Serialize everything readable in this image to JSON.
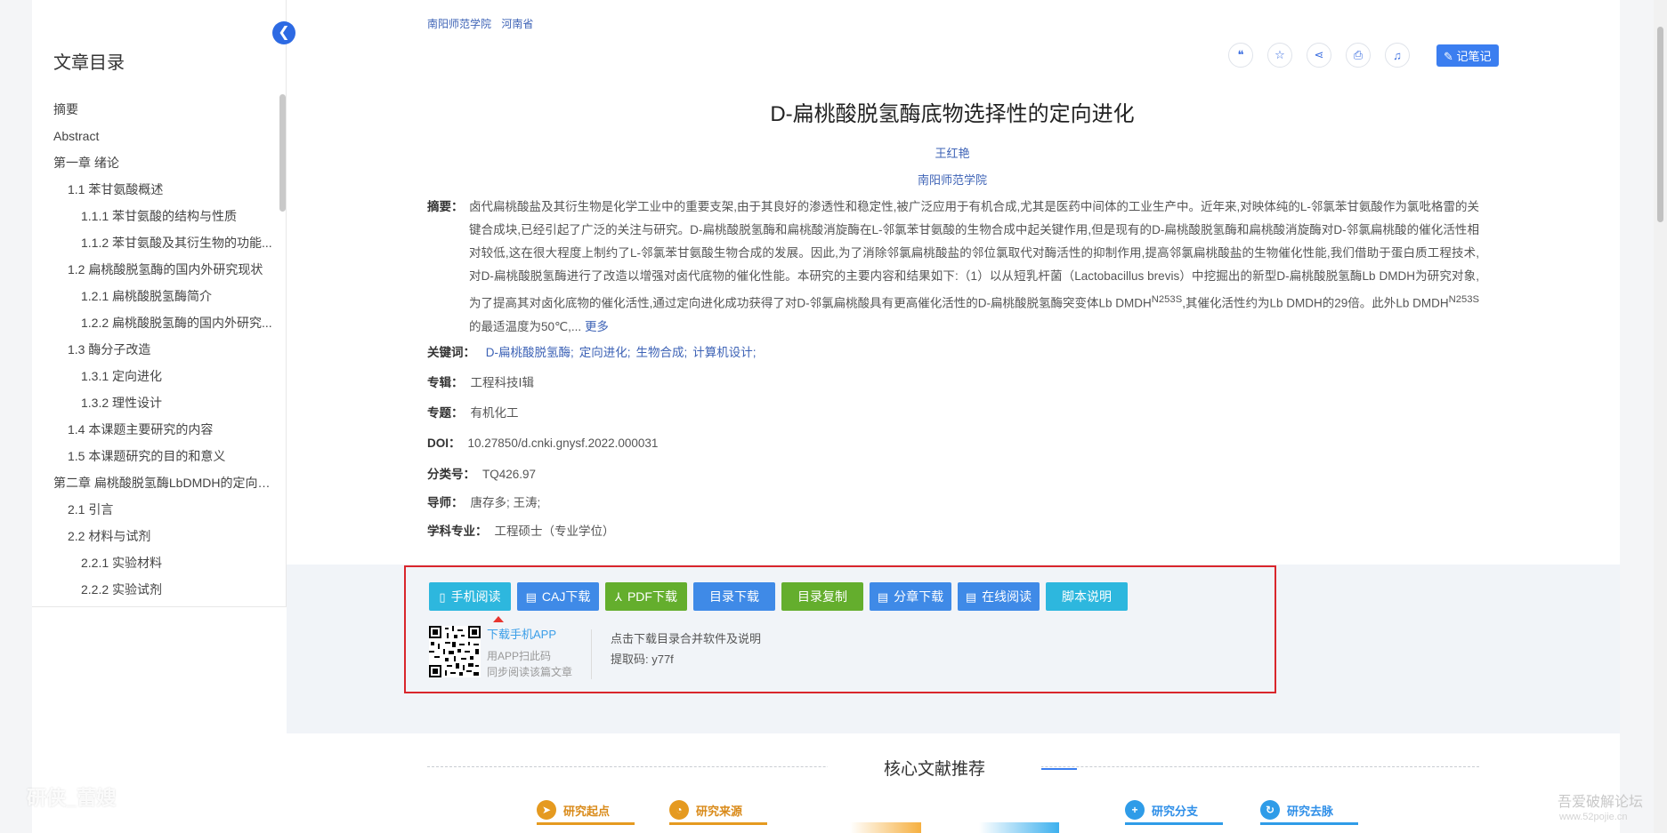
{
  "sidebar": {
    "title": "文章目录",
    "collapse_icon": "chevron-left-icon",
    "items": [
      {
        "label": "摘要",
        "level": 1
      },
      {
        "label": "Abstract",
        "level": 1
      },
      {
        "label": "第一章 绪论",
        "level": 1
      },
      {
        "label": "1.1 苯甘氨酸概述",
        "level": 2
      },
      {
        "label": "1.1.1 苯甘氨酸的结构与性质",
        "level": 3
      },
      {
        "label": "1.1.2 苯甘氨酸及其衍生物的功能...",
        "level": 3
      },
      {
        "label": "1.2 扁桃酸脱氢酶的国内外研究现状",
        "level": 2
      },
      {
        "label": "1.2.1 扁桃酸脱氢酶简介",
        "level": 3
      },
      {
        "label": "1.2.2 扁桃酸脱氢酶的国内外研究...",
        "level": 3
      },
      {
        "label": "1.3 酶分子改造",
        "level": 2
      },
      {
        "label": "1.3.1 定向进化",
        "level": 3
      },
      {
        "label": "1.3.2 理性设计",
        "level": 3
      },
      {
        "label": "1.4 本课题主要研究的内容",
        "level": 2
      },
      {
        "label": "1.5 本课题研究的目的和意义",
        "level": 2
      },
      {
        "label": "第二章 扁桃酸脱氢酶LbDMDH的定向进...",
        "level": 1
      },
      {
        "label": "2.1 引言",
        "level": 2
      },
      {
        "label": "2.2 材料与试剂",
        "level": 2
      },
      {
        "label": "2.2.1 实验材料",
        "level": 3
      },
      {
        "label": "2.2.2 实验试剂",
        "level": 3
      }
    ]
  },
  "header": {
    "institution": "南阳师范学院",
    "province": "河南省"
  },
  "toolbar": {
    "icons": [
      "quote-icon",
      "star-icon",
      "share-icon",
      "print-icon",
      "bell-icon"
    ],
    "note_label": "记笔记"
  },
  "article": {
    "title": "D-扁桃酸脱氢酶底物选择性的定向进化",
    "author": "王红艳",
    "organization": "南阳师范学院",
    "abstract_label": "摘要：",
    "abstract_text_1": "卤代扁桃酸盐及其衍生物是化学工业中的重要支架,由于其良好的渗透性和稳定性,被广泛应用于有机合成,尤其是医药中间体的工业生产中。近年来,对映体纯的L-邻氯苯甘氨酸作为氯吡格雷的关键合成块,已经引起了广泛的关注与研究。D-扁桃酸脱氢酶和扁桃酸消旋酶在L-邻氯苯甘氨酸的生物合成中起关键作用,但是现有的D-扁桃酸脱氢酶和扁桃酸消旋酶对D-邻氯扁桃酸的催化活性相对较低,这在很大程度上制约了L-邻氯苯甘氨酸生物合成的发展。因此,为了消除邻氯扁桃酸盐的邻位氯取代对酶活性的抑制作用,提高邻氯扁桃酸盐的生物催化性能,我们借助于蛋白质工程技术,对D-扁桃酸脱氢酶进行了改造以增强对卤代底物的催化性能。本研究的主要内容和结果如下:（1）以从短乳杆菌（Lactobacillus brevis）中挖掘出的新型D-扁桃酸脱氢酶Lb DMDH为研究对象,为了提高其对卤化底物的催化活性,通过定向进化成功获得了对D-邻氯扁桃酸具有更高催化活性的D-扁桃酸脱氢酶突变体Lb DMDH",
    "abstract_sup_1": "N253S",
    "abstract_text_2": ",其催化活性约为Lb DMDH的29倍。此外Lb DMDH",
    "abstract_sup_2": "N253S",
    "abstract_text_3": "的最适温度为50℃,... ",
    "more_label": "更多",
    "keywords_label": "关键词：",
    "keywords": [
      "D-扁桃酸脱氢酶;",
      "定向进化;",
      "生物合成;",
      "计算机设计;"
    ],
    "series_label": "专辑：",
    "series": "工程科技Ⅰ辑",
    "topic_label": "专题：",
    "topic": "有机化工",
    "doi_label": "DOI：",
    "doi": "10.27850/d.cnki.gnysf.2022.000031",
    "class_label": "分类号：",
    "class_no": "TQ426.97",
    "advisor_label": "导师：",
    "advisor": "唐存多; 王涛;",
    "major_label": "学科专业：",
    "major": "工程硕士（专业学位）"
  },
  "downloads": {
    "buttons": [
      {
        "label": "手机阅读",
        "icon": "phone-icon",
        "color": "#2db7de"
      },
      {
        "label": "CAJ下载",
        "icon": "book-icon",
        "color": "#3f8ae7"
      },
      {
        "label": "PDF下载",
        "icon": "pdf-icon",
        "color": "#64ae2d"
      },
      {
        "label": "目录下载",
        "icon": "",
        "color": "#3f8ae7"
      },
      {
        "label": "目录复制",
        "icon": "",
        "color": "#64ae2d"
      },
      {
        "label": "分章下载",
        "icon": "book-icon",
        "color": "#3f8ae7"
      },
      {
        "label": "在线阅读",
        "icon": "book-icon",
        "color": "#3f8ae7"
      },
      {
        "label": "脚本说明",
        "icon": "",
        "color": "#2db7de"
      }
    ],
    "app_link": "下载手机APP",
    "app_scan": "用APP扫此码",
    "app_sync": "同步阅读该篇文章",
    "tip_line": "点击下载目录合并软件及说明",
    "code_line": "提取码: y77f"
  },
  "recommend": {
    "title": "核心文献推荐",
    "tabs": [
      {
        "label": "研究起点",
        "icon": "send-icon"
      },
      {
        "label": "研究来源",
        "icon": "pie-icon"
      },
      {
        "label": "研究分支",
        "icon": "plus-circle-icon"
      },
      {
        "label": "研究去脉",
        "icon": "refresh-icon"
      }
    ]
  },
  "watermarks": {
    "left": "研侠_蕾嫂",
    "right": "吾爱破解论坛",
    "right_url": "www.52pojie.cn"
  }
}
